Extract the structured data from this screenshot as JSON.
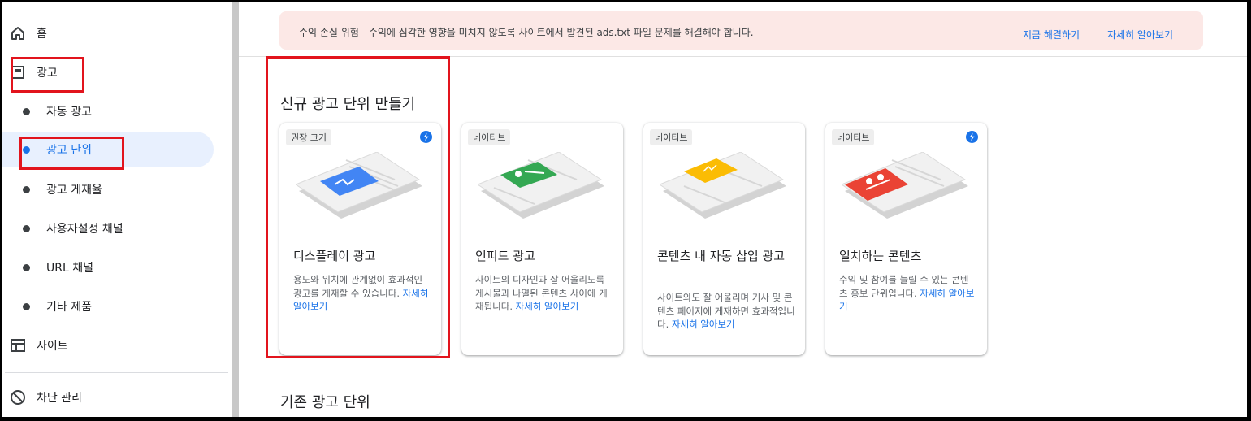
{
  "sidebar": {
    "items": [
      {
        "label": "홈",
        "icon": "home-icon"
      },
      {
        "label": "광고",
        "icon": "ads-icon"
      },
      {
        "label": "자동 광고"
      },
      {
        "label": "광고 단위"
      },
      {
        "label": "광고 게재율"
      },
      {
        "label": "사용자설정 채널"
      },
      {
        "label": "URL 채널"
      },
      {
        "label": "기타 제품"
      },
      {
        "label": "사이트",
        "icon": "sites-icon"
      },
      {
        "label": "차단 관리",
        "icon": "block-icon"
      }
    ],
    "active_index": 3
  },
  "banner": {
    "message": "수익 손실 위험 - 수익에 심각한 영향을 미치지 않도록 사이트에서 발견된 ads.txt 파일 문제를 해결해야 합니다.",
    "fix_link": "지금 해결하기",
    "learn_link": "자세히 알아보기"
  },
  "main": {
    "new_title": "신규 광고 단위 만들기",
    "existing_title": "기존 광고 단위"
  },
  "cards": [
    {
      "tag": "권장 크기",
      "bolt": true,
      "accent": "#4285f4",
      "title": "디스플레이 광고",
      "desc": "용도와 위치에 관계없이 효과적인 광고를 게재할 수 있습니다.",
      "more": "자세히 알아보기"
    },
    {
      "tag": "네이티브",
      "bolt": false,
      "accent": "#34a853",
      "title": "인피드 광고",
      "desc": "사이트의 디자인과 잘 어울리도록 게시물과 나열된 콘텐츠 사이에 게재됩니다.",
      "more": "자세히 알아보기"
    },
    {
      "tag": "네이티브",
      "bolt": false,
      "accent": "#fbbc04",
      "title": "콘텐츠 내 자동 삽입 광고",
      "desc": "사이트와도 잘 어울리며 기사 및 콘텐츠 페이지에 게재하면 효과적입니다.",
      "more": "자세히 알아보기"
    },
    {
      "tag": "네이티브",
      "bolt": true,
      "accent": "#ea4335",
      "title": "일치하는 콘텐츠",
      "desc": "수익 및 참여를 늘릴 수 있는 콘텐츠 홍보 단위입니다.",
      "more": "자세히 알아보기"
    }
  ],
  "colors": {
    "highlight_box": "#e2141d",
    "link": "#1a73e8",
    "active_bg": "#e8f0fe",
    "banner_bg": "#fce8e6"
  }
}
